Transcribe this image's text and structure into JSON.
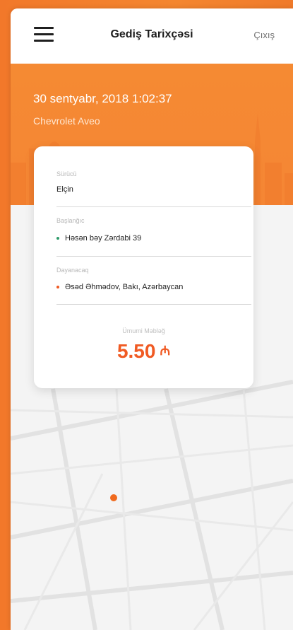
{
  "navbar": {
    "title": "Gediş Tarixçəsi",
    "exit_label": "Çıxış",
    "menu_icon": "hamburger-menu-icon"
  },
  "trip": {
    "datetime": "30 sentyabr, 2018  1:02:37",
    "car": "Chevrolet Aveo"
  },
  "details": {
    "driver_label": "Sürücü",
    "driver_value": "Elçin",
    "start_label": "Başlanğıc",
    "start_value": "Həsən bəy Zərdabi 39",
    "stop_label": "Dayanacaq",
    "stop_value": "Əsəd Əhmədov, Bakı, Azərbaycan",
    "total_label": "Ümumi Məbləğ",
    "total_value": "5.50",
    "currency_symbol": "₼"
  },
  "colors": {
    "accent": "#f05a23",
    "header_orange": "#f58634",
    "start_dot": "#2f9c6b",
    "stop_dot": "#f05a23"
  }
}
